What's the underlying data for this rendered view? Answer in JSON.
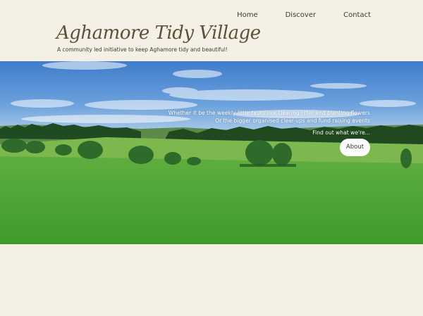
{
  "header": {
    "title": "Aghamore Tidy Village",
    "tagline": "A community led initiative to keep Aghamore tidy and beautiful!"
  },
  "nav": {
    "items": [
      {
        "label": "Home"
      },
      {
        "label": "Discover"
      },
      {
        "label": "Contact"
      }
    ]
  },
  "hero": {
    "line1": "Whether it be the weekly little tasks like clearing litter and planting flowers",
    "line2": "Or the bigger organised clear-ups and fund raising events",
    "cta_text": "Find out what we're...",
    "button_label": "About"
  },
  "colors": {
    "background": "#f5f0e6",
    "title": "#5a5238",
    "sky": "#4a86d0",
    "grass": "#4fa83a"
  }
}
